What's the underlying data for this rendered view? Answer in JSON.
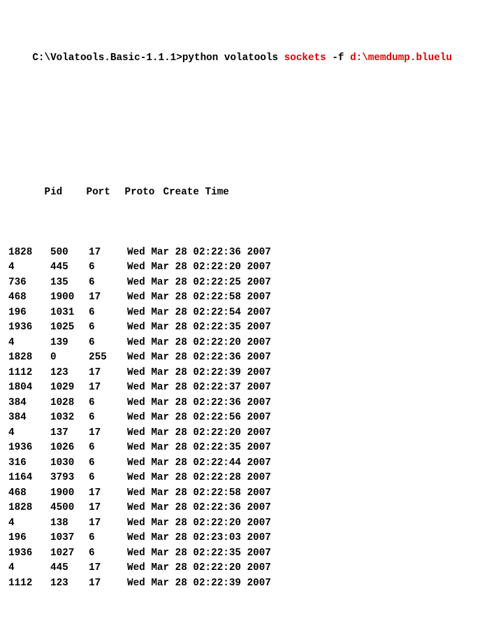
{
  "prompt": {
    "cwd": "C:\\Volatools.Basic-1.1.1>",
    "cmd1": "python volatools ",
    "cmd_highlight1": "sockets ",
    "flag": "-f ",
    "cmd_highlight2": "d:\\memdump.bluelu"
  },
  "headers": {
    "pid": "Pid",
    "port": "Port",
    "proto": "Proto",
    "time": "Create Time"
  },
  "rows": [
    {
      "pid": "1828",
      "port": "500",
      "proto": "17",
      "time": "Wed Mar 28 02:22:36 2007"
    },
    {
      "pid": "4",
      "port": "445",
      "proto": "6",
      "time": "Wed Mar 28 02:22:20 2007"
    },
    {
      "pid": "736",
      "port": "135",
      "proto": "6",
      "time": "Wed Mar 28 02:22:25 2007"
    },
    {
      "pid": "468",
      "port": "1900",
      "proto": "17",
      "time": "Wed Mar 28 02:22:58 2007"
    },
    {
      "pid": "196",
      "port": "1031",
      "proto": "6",
      "time": "Wed Mar 28 02:22:54 2007"
    },
    {
      "pid": "1936",
      "port": "1025",
      "proto": "6",
      "time": "Wed Mar 28 02:22:35 2007"
    },
    {
      "pid": "4",
      "port": "139",
      "proto": "6",
      "time": "Wed Mar 28 02:22:20 2007"
    },
    {
      "pid": "1828",
      "port": "0",
      "proto": "255",
      "time": "Wed Mar 28 02:22:36 2007"
    },
    {
      "pid": "1112",
      "port": "123",
      "proto": "17",
      "time": "Wed Mar 28 02:22:39 2007"
    },
    {
      "pid": "1804",
      "port": "1029",
      "proto": "17",
      "time": "Wed Mar 28 02:22:37 2007"
    },
    {
      "pid": "384",
      "port": "1028",
      "proto": "6",
      "time": "Wed Mar 28 02:22:36 2007"
    },
    {
      "pid": "384",
      "port": "1032",
      "proto": "6",
      "time": "Wed Mar 28 02:22:56 2007"
    },
    {
      "pid": "4",
      "port": "137",
      "proto": "17",
      "time": "Wed Mar 28 02:22:20 2007"
    },
    {
      "pid": "1936",
      "port": "1026",
      "proto": "6",
      "time": "Wed Mar 28 02:22:35 2007"
    },
    {
      "pid": "316",
      "port": "1030",
      "proto": "6",
      "time": "Wed Mar 28 02:22:44 2007"
    },
    {
      "pid": "1164",
      "port": "3793",
      "proto": "6",
      "time": "Wed Mar 28 02:22:28 2007"
    },
    {
      "pid": "468",
      "port": "1900",
      "proto": "17",
      "time": "Wed Mar 28 02:22:58 2007"
    },
    {
      "pid": "1828",
      "port": "4500",
      "proto": "17",
      "time": "Wed Mar 28 02:22:36 2007"
    },
    {
      "pid": "4",
      "port": "138",
      "proto": "17",
      "time": "Wed Mar 28 02:22:20 2007"
    },
    {
      "pid": "196",
      "port": "1037",
      "proto": "6",
      "time": "Wed Mar 28 02:23:03 2007"
    },
    {
      "pid": "1936",
      "port": "1027",
      "proto": "6",
      "time": "Wed Mar 28 02:22:35 2007"
    },
    {
      "pid": "4",
      "port": "445",
      "proto": "17",
      "time": "Wed Mar 28 02:22:20 2007"
    },
    {
      "pid": "1112",
      "port": "123",
      "proto": "17",
      "time": "Wed Mar 28 02:22:39 2007"
    }
  ]
}
